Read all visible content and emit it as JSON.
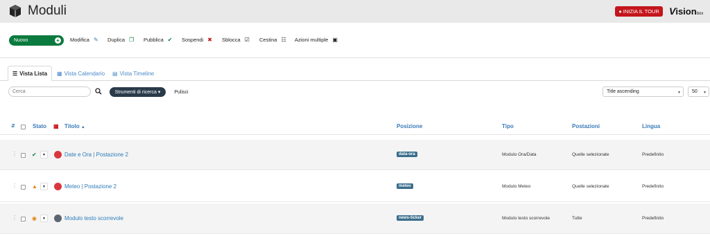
{
  "header": {
    "title": "Moduli",
    "tour_label": "INIZIA IL TOUR",
    "logo": {
      "v": "V",
      "sion": "ision",
      "box": "box"
    }
  },
  "toolbar": {
    "new_label": "Nuovo",
    "items": [
      {
        "label": "Modifica",
        "icon": "edit-icon"
      },
      {
        "label": "Duplica",
        "icon": "copy-icon"
      },
      {
        "label": "Pubblica",
        "icon": "check-icon"
      },
      {
        "label": "Sospendi",
        "icon": "times-circle-icon"
      },
      {
        "label": "Sblocca",
        "icon": "checkbox-icon"
      },
      {
        "label": "Cestina",
        "icon": "trash-icon"
      },
      {
        "label": "Azioni multiple",
        "icon": "square-check-icon"
      }
    ]
  },
  "tabs": [
    {
      "label": "Vista Lista",
      "active": true
    },
    {
      "label": "Vista Calendario",
      "active": false
    },
    {
      "label": "Vista Timeline",
      "active": false
    }
  ],
  "search": {
    "placeholder": "Cerca",
    "tools_label": "Strumenti di ricerca",
    "clear_label": "Pulisci"
  },
  "sort": {
    "selected": "Title ascending",
    "limit": "50"
  },
  "columns": {
    "stato": "Stato",
    "titolo": "Titolo",
    "posizione": "Posizione",
    "tipo": "Tipo",
    "postazioni": "Postazioni",
    "lingua": "Lingua"
  },
  "rows": [
    {
      "title": "Date e Ora | Postazione 2",
      "status": "published",
      "dot_color": "#d9363e",
      "position": "data-ora",
      "type": "Modulo Ora/Data",
      "stations": "Quelle selezionate",
      "language": "Predefinito"
    },
    {
      "title": "Meteo | Postazione 2",
      "status": "warning",
      "dot_color": "#d9363e",
      "position": "meteo",
      "type": "Modulo Meteo",
      "stations": "Quelle selezionate",
      "language": "Predefinito"
    },
    {
      "title": "Modulo testo scorrevole",
      "status": "expired",
      "dot_color": "#5a6570",
      "position": "news-ticker",
      "type": "Modulo testo scorrevole",
      "stations": "Tutte",
      "language": "Predefinito"
    }
  ],
  "colors": {
    "primary": "#0b7a3e",
    "danger": "#c4161c",
    "link": "#2b7bb9",
    "badge": "#3a6d8c"
  }
}
